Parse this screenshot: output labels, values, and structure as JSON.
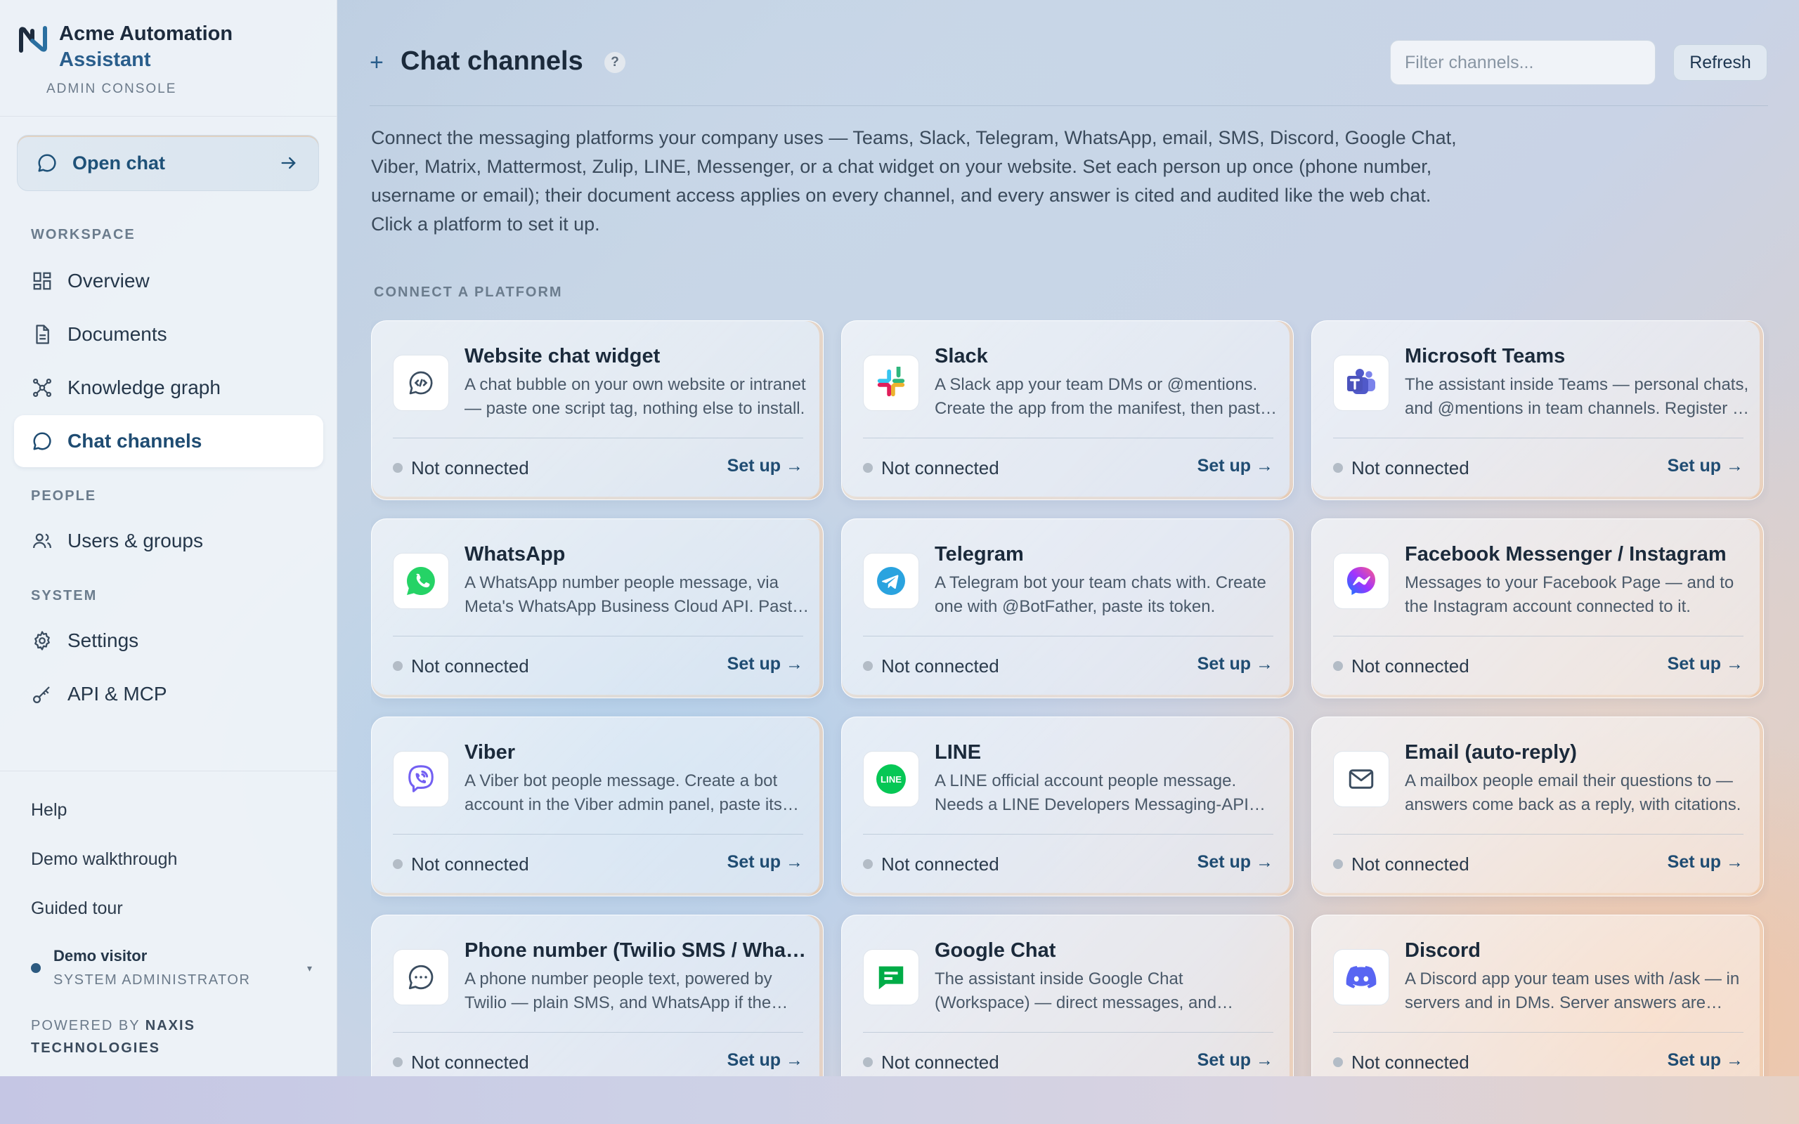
{
  "brand": {
    "name_line1": "Acme Automation",
    "name_line2": "Assistant",
    "subtitle": "ADMIN CONSOLE"
  },
  "sidebar": {
    "open_chat_label": "Open chat",
    "sections": {
      "workspace": "WORKSPACE",
      "people": "PEOPLE",
      "system": "SYSTEM"
    },
    "items": [
      {
        "label": "Overview",
        "icon": "grid-icon"
      },
      {
        "label": "Documents",
        "icon": "document-icon"
      },
      {
        "label": "Knowledge graph",
        "icon": "graph-icon"
      },
      {
        "label": "Chat channels",
        "icon": "chat-icon",
        "active": true
      },
      {
        "label": "Users & groups",
        "icon": "users-icon"
      },
      {
        "label": "Settings",
        "icon": "gear-icon"
      },
      {
        "label": "API & MCP",
        "icon": "key-icon"
      }
    ],
    "footer_links": [
      "Help",
      "Demo walkthrough",
      "Guided tour"
    ],
    "visitor": {
      "name": "Demo visitor",
      "role": "SYSTEM ADMINISTRATOR"
    },
    "powered_prefix": "POWERED BY",
    "powered_brand": "NAXIS TECHNOLOGIES"
  },
  "header": {
    "title": "Chat channels",
    "help": "?",
    "filter_placeholder": "Filter channels...",
    "refresh_label": "Refresh"
  },
  "intro": "Connect the messaging platforms your company uses — Teams, Slack, Telegram, WhatsApp, email, SMS, Discord, Google Chat, Viber, Matrix, Mattermost, Zulip, LINE, Messenger, or a chat widget on your website. Set each person up once (phone number, username or email); their document access applies on every channel, and every answer is cited and audited like the web chat. Click a platform to set it up.",
  "connect_label": "CONNECT A PLATFORM",
  "status_label": "Not connected",
  "setup_label": "Set up →",
  "channels": [
    {
      "name": "Website chat widget",
      "desc": "A chat bubble on your own website or intranet — paste one script tag, nothing else to install.",
      "icon": "code-chat-icon"
    },
    {
      "name": "Slack",
      "desc": "A Slack app your team DMs or @mentions. Create the app from the manifest, then paste its tokens.",
      "icon": "slack-icon"
    },
    {
      "name": "Microsoft Teams",
      "desc": "The assistant inside Teams — personal chats, and @mentions in team channels. Register a bot, then paste its app ID.",
      "icon": "teams-icon"
    },
    {
      "name": "WhatsApp",
      "desc": "A WhatsApp number people message, via Meta's WhatsApp Business Cloud API. Paste your access token.",
      "icon": "whatsapp-icon"
    },
    {
      "name": "Telegram",
      "desc": "A Telegram bot your team chats with. Create one with @BotFather, paste its token.",
      "icon": "telegram-icon"
    },
    {
      "name": "Facebook Messenger / Instagram",
      "desc": "Messages to your Facebook Page — and to the Instagram account connected to it.",
      "icon": "messenger-icon"
    },
    {
      "name": "Viber",
      "desc": "A Viber bot people message. Create a bot account in the Viber admin panel, paste its token.",
      "icon": "viber-icon"
    },
    {
      "name": "LINE",
      "desc": "A LINE official account people message. Needs a LINE Developers Messaging-API channel.",
      "icon": "line-icon"
    },
    {
      "name": "Email (auto-reply)",
      "desc": "A mailbox people email their questions to — answers come back as a reply, with citations.",
      "icon": "mail-icon"
    },
    {
      "name": "Phone number (Twilio SMS / WhatsApp)",
      "desc": "A phone number people text, powered by Twilio — plain SMS, and WhatsApp if the number is enabled.",
      "icon": "sms-icon"
    },
    {
      "name": "Google Chat",
      "desc": "The assistant inside Google Chat (Workspace) — direct messages, and @mentions in spaces.",
      "icon": "google-chat-icon"
    },
    {
      "name": "Discord",
      "desc": "A Discord app your team uses with /ask — in servers and in DMs. Server answers are public.",
      "icon": "discord-icon"
    }
  ],
  "colors": {
    "accent": "#1f4c72",
    "brand_blue": "#2a5e8c",
    "status_dot": "#b3bcc6"
  }
}
